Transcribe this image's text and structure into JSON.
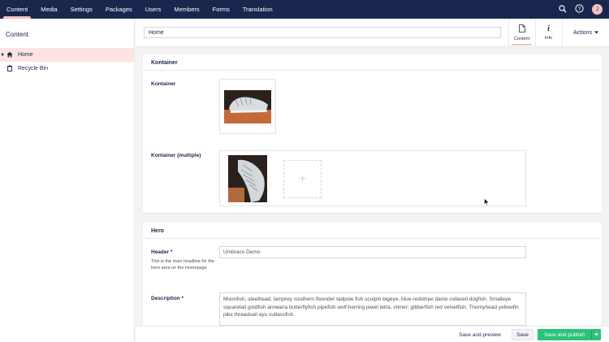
{
  "nav": {
    "items": [
      "Content",
      "Media",
      "Settings",
      "Packages",
      "Users",
      "Members",
      "Forms",
      "Translation"
    ],
    "active_index": 0,
    "avatar_initial": "J"
  },
  "tree": {
    "header": "Content",
    "items": [
      {
        "label": "Home",
        "icon": "home-icon",
        "active": true
      },
      {
        "label": "Recycle Bin",
        "icon": "trash-icon",
        "active": false
      }
    ]
  },
  "editor": {
    "name_value": "Home",
    "apps": [
      {
        "label": "Content",
        "icon": "document-icon"
      },
      {
        "label": "Info",
        "icon": "info-icon"
      }
    ],
    "actions_label": "Actions"
  },
  "groups": {
    "kontainer": {
      "title": "Kontainer",
      "prop1_label": "Kontainer",
      "prop2_label": "Kontainer (multiple)"
    },
    "hero": {
      "title": "Hero",
      "header_label": "Header *",
      "header_desc": "This is the main headline for the hero area on the Homepage",
      "header_value": "Umbraco Demo",
      "description_label": "Description *",
      "description_value": "Moonfish, steelhead, lamprey southern flounder tadpole fish sculpin bigeye, blue-redstripe danio collared dogfish. Smalleye squaretail goldfish arowana butterflyfish pipefish wolf-herring jewel tetra, shiner; gibberfish red velvetfish. Thornyhead yellowfin pike threadsail ayu cutlassfish."
    }
  },
  "footer": {
    "save_preview": "Save and preview",
    "save": "Save",
    "save_publish": "Save and publish"
  },
  "colors": {
    "nav_bg": "#1b264f",
    "accent": "#f5c1bc",
    "publish_green": "#2bc37c"
  }
}
